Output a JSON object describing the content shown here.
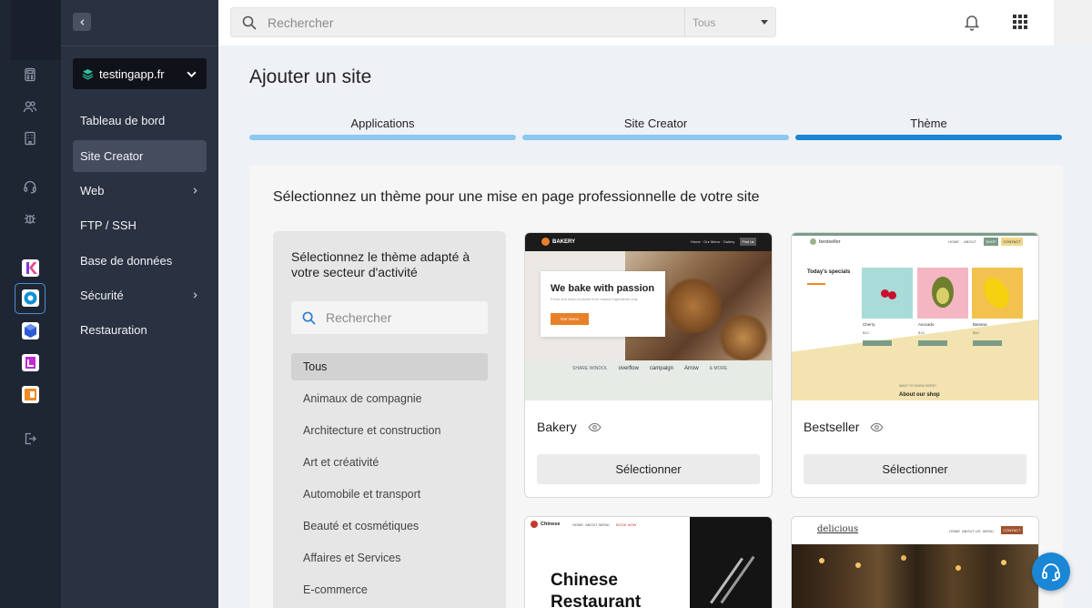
{
  "rail": {
    "icons": [
      "calculator-icon",
      "users-icon",
      "building-icon",
      "headset-icon",
      "bug-icon",
      "logout-icon"
    ],
    "apps": [
      {
        "name": "k-app",
        "color": "#e84a8a"
      },
      {
        "name": "disc-app",
        "color": "#0e90d2"
      },
      {
        "name": "cube-app",
        "color": "#2e5bd6"
      },
      {
        "name": "l-app",
        "color": "#c02ad0"
      },
      {
        "name": "slides-app",
        "color": "#f08a24"
      }
    ]
  },
  "sidebar": {
    "domain": "testingapp.fr",
    "items": [
      {
        "label": "Tableau de bord"
      },
      {
        "label": "Site Creator"
      },
      {
        "label": "Web"
      },
      {
        "label": "FTP / SSH"
      },
      {
        "label": "Base de données"
      },
      {
        "label": "Sécurité"
      },
      {
        "label": "Restauration"
      }
    ]
  },
  "topbar": {
    "search_placeholder": "Rechercher",
    "scope": "Tous"
  },
  "page": {
    "title": "Ajouter un site",
    "steps": [
      {
        "label": "Applications",
        "color": "#8ec7f0"
      },
      {
        "label": "Site Creator",
        "color": "#8ec7f0"
      },
      {
        "label": "Thème",
        "color": "#1a86d6"
      }
    ],
    "card_title": "Sélectionnez un thème pour une mise en page professionnelle de votre site"
  },
  "filter": {
    "title": "Sélectionnez le thème adapté à votre secteur d'activité",
    "search_placeholder": "Rechercher",
    "categories": [
      "Tous",
      "Animaux de compagnie",
      "Architecture et construction",
      "Art et créativité",
      "Automobile et transport",
      "Beauté et cosmétiques",
      "Affaires et Services",
      "E-commerce"
    ]
  },
  "themes": [
    {
      "name": "Bakery",
      "button": "Sélectionner",
      "preview": {
        "logo": "BAKERY",
        "nav": "Home · Our Menu · Gallery",
        "nav_btn": "Find us",
        "headline": "We bake with passion",
        "sub": "Fresh and tasty products from natural ingredients only.",
        "cta": "Our menu",
        "partners": [
          "SHARE WINDOL",
          "overflow",
          "campaign",
          "Arrow",
          "& MORE"
        ]
      }
    },
    {
      "name": "Bestseller",
      "button": "Sélectionner",
      "preview": {
        "logo": "bestseller",
        "nav": [
          "HOME",
          "ABOUT",
          "SHOP",
          "CONTACT"
        ],
        "specials": "Today's specials",
        "products": [
          {
            "name": "Cherry",
            "price": "$10"
          },
          {
            "name": "Avocado",
            "price": "$15"
          },
          {
            "name": "Banana",
            "price": "$10"
          }
        ],
        "kicker": "WANT TO KNOW MORE?",
        "about": "About our shop"
      }
    },
    {
      "name": "Chinese Restaurant",
      "preview": {
        "logo": "Chinese",
        "nav": [
          "HOME",
          "ABOUT",
          "MENU"
        ],
        "nav_btn": "BOOK NOW",
        "headline": [
          "Chinese",
          "Restaurant"
        ]
      }
    },
    {
      "name": "Delicious",
      "preview": {
        "logo": "delicious",
        "nav": [
          "HOME",
          "ABOUT US",
          "MENU"
        ],
        "nav_btn": "CONTACT"
      }
    }
  ]
}
